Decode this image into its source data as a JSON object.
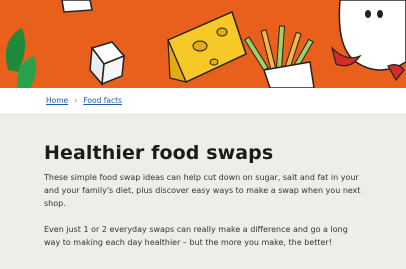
{
  "hero": {
    "background_color": "#e8601c",
    "illustration_items": [
      "sugar-cube-icon",
      "cheese-icon",
      "vegetable-sticks-icon",
      "apple-icon"
    ]
  },
  "breadcrumb": {
    "items": [
      {
        "label": "Home"
      },
      {
        "label": "Food facts"
      }
    ],
    "separator": "›"
  },
  "article": {
    "title": "Healthier food swaps",
    "intro": "These simple food swap ideas can help cut down on sugar, salt and fat in your and your family's diet, plus discover easy ways to make a swap when you next shop.",
    "body": "Even just 1 or 2 everyday swaps can really make a difference and go a long way to making each day healthier – but the more you make, the better!"
  },
  "colors": {
    "link": "#1d5dac",
    "panel_background": "#efede8",
    "hero_orange": "#e8601c"
  }
}
